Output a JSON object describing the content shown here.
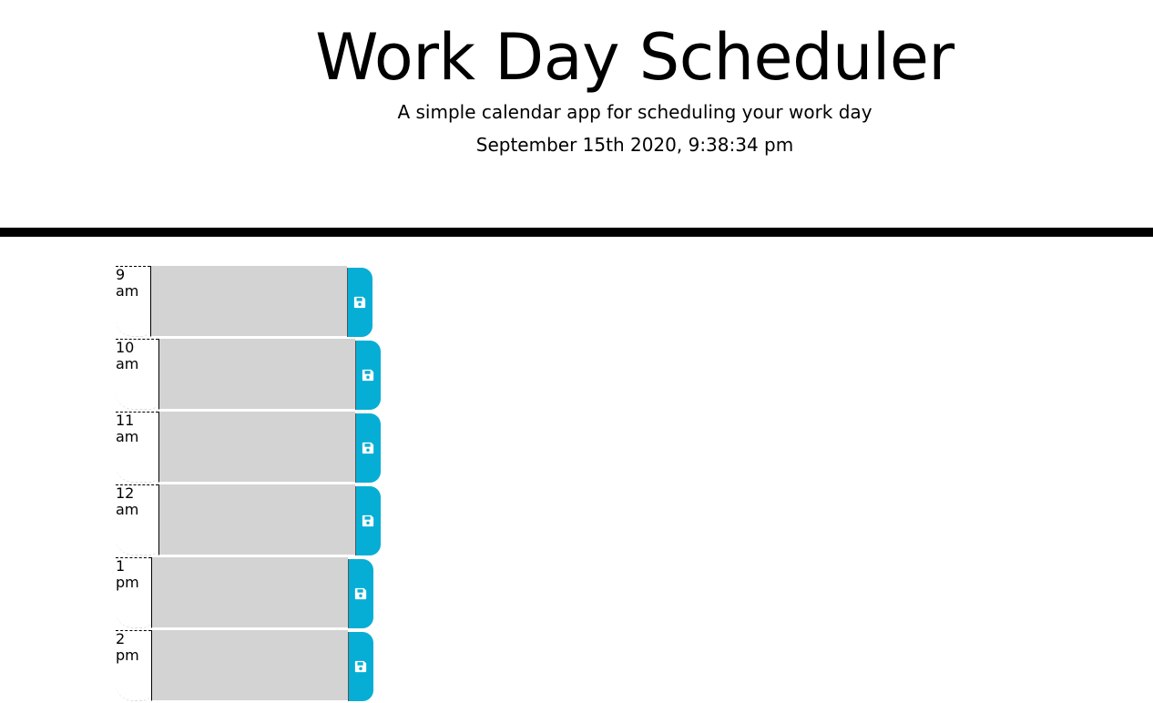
{
  "header": {
    "title": "Work Day Scheduler",
    "lead": "A simple calendar app for scheduling your work day",
    "current_day": "September 15th 2020, 9:38:34 pm"
  },
  "time_blocks": [
    {
      "hour": "9 am",
      "description": "",
      "save_icon": "save-icon"
    },
    {
      "hour": "10 am",
      "description": "",
      "save_icon": "save-icon"
    },
    {
      "hour": "11 am",
      "description": "",
      "save_icon": "save-icon"
    },
    {
      "hour": "12 am",
      "description": "",
      "save_icon": "save-icon"
    },
    {
      "hour": "1 pm",
      "description": "",
      "save_icon": "save-icon"
    },
    {
      "hour": "2 pm",
      "description": "",
      "save_icon": "save-icon"
    }
  ],
  "colors": {
    "past_block": "#d3d3d3",
    "save_button": "#06aed5",
    "divider": "#000000"
  }
}
